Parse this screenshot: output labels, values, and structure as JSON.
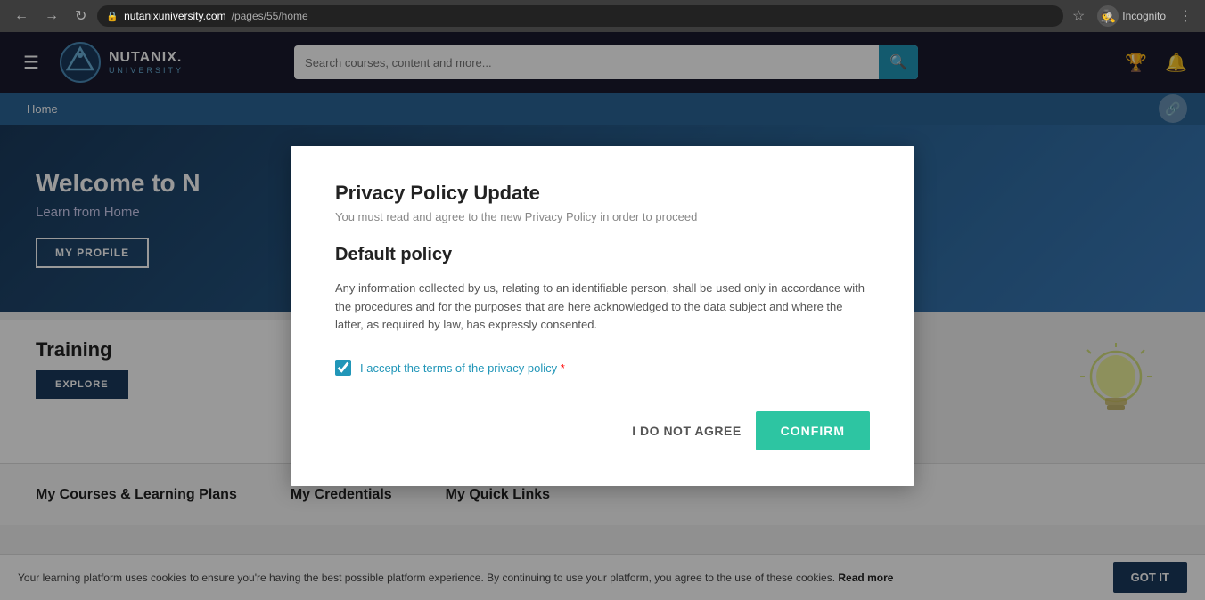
{
  "browser": {
    "url_domain": "nutanixuniversity.com",
    "url_path": "/pages/55/home",
    "incognito_label": "Incognito"
  },
  "header": {
    "menu_label": "☰",
    "logo_text_line1": "NUTANIX.",
    "logo_text_line2": "UNIVERSITY",
    "search_placeholder": "Search courses, content and more...",
    "search_icon": "🔍"
  },
  "navbar": {
    "home_label": "Home",
    "link_icon": "🔗"
  },
  "hero": {
    "title": "Welcome to N",
    "subtitle": "Learn from Home",
    "profile_btn": "MY PROFILE"
  },
  "training": {
    "title": "Training",
    "explore_btn": "EXPLORE"
  },
  "bottom": {
    "courses_label": "My Courses & Learning Plans",
    "credentials_label": "My Credentials",
    "quick_links_label": "My Quick Links"
  },
  "cookie": {
    "text": "Your learning platform uses cookies to ensure you're having the best possible platform experience. By continuing to use your platform, you agree to the use of these cookies.",
    "read_more": "Read more",
    "got_it": "GOT IT"
  },
  "modal": {
    "title": "Privacy Policy Update",
    "subtitle": "You must read and agree to the new Privacy Policy in order to proceed",
    "policy_title": "Default policy",
    "policy_text": "Any information collected by us, relating to an identifiable person, shall be used only in accordance with the procedures and for the purposes that are here acknowledged to the data subject and where the latter, as required by law, has expressly consented.",
    "checkbox_label": "I accept the terms of the privacy policy",
    "required_star": "*",
    "do_not_agree": "I DO NOT AGREE",
    "confirm": "CONFIRM"
  }
}
